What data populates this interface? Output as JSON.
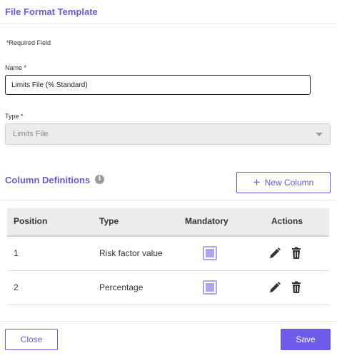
{
  "dialog": {
    "title": "File Format Template"
  },
  "form": {
    "required_note": "*Required Field",
    "name_label": "Name *",
    "name_value": "Limits File (% Standard)",
    "type_label": "Type *",
    "type_value": "Limits File"
  },
  "columns": {
    "title": "Column Definitions",
    "info_icon": "info-icon",
    "new_button": "New Column",
    "headers": {
      "position": "Position",
      "type": "Type",
      "mandatory": "Mandatory",
      "actions": "Actions"
    },
    "rows": [
      {
        "position": "1",
        "type": "Risk factor value",
        "mandatory": true
      },
      {
        "position": "2",
        "type": "Percentage",
        "mandatory": true
      }
    ]
  },
  "footer": {
    "close_label": "Close",
    "save_label": "Save"
  },
  "colors": {
    "accent": "#6a5acd",
    "save_bg": "#6c5ce7",
    "checkbox": "#b0a6f0"
  }
}
